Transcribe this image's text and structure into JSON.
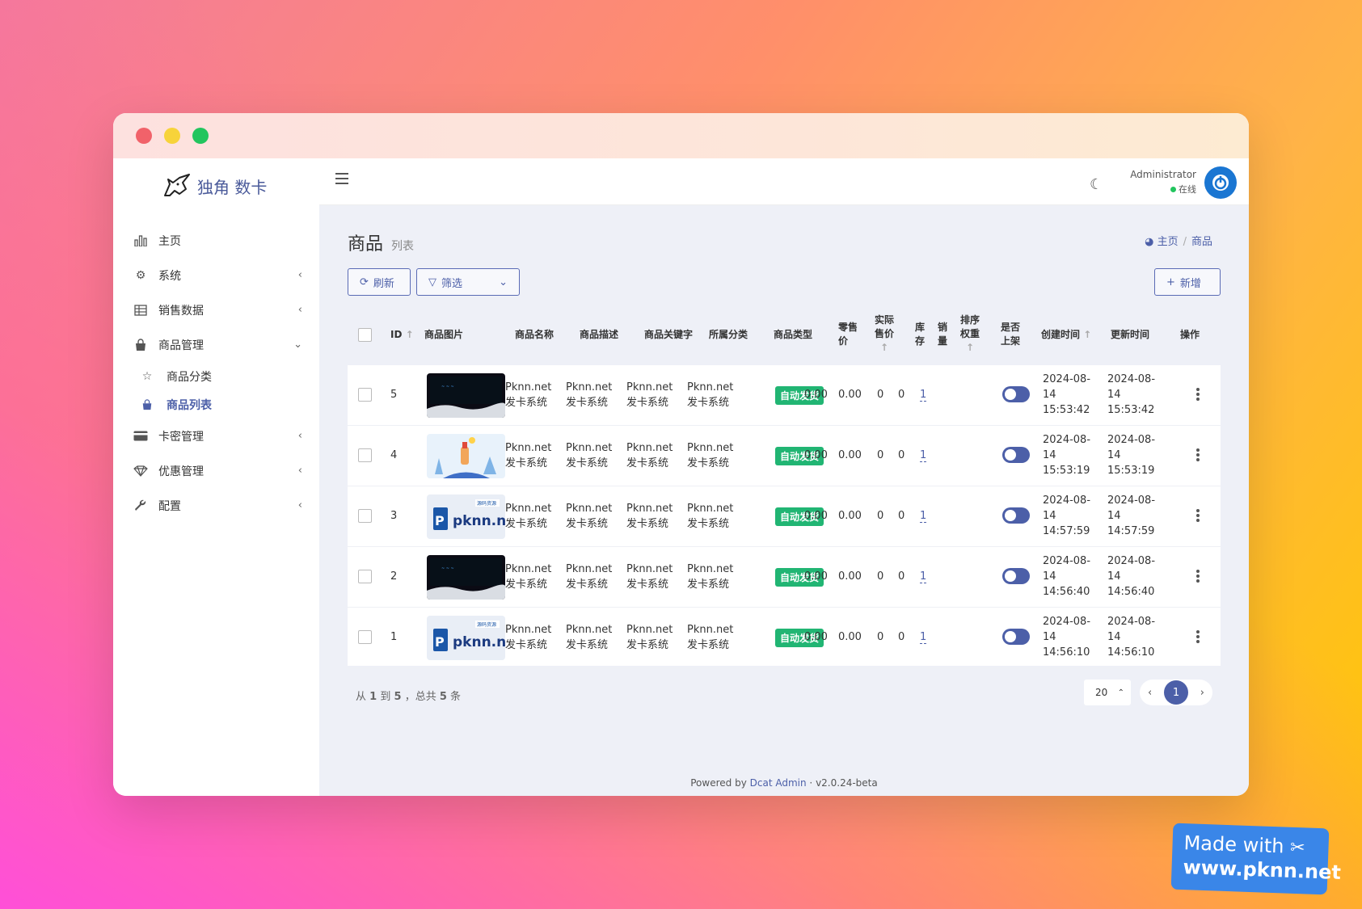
{
  "brand": {
    "name": "独角 数卡"
  },
  "sidebar": {
    "items": [
      {
        "label": "主页"
      },
      {
        "label": "系统"
      },
      {
        "label": "销售数据"
      },
      {
        "label": "商品管理"
      },
      {
        "label": "卡密管理"
      },
      {
        "label": "优惠管理"
      },
      {
        "label": "配置"
      }
    ],
    "sub_items": [
      {
        "label": "商品分类"
      },
      {
        "label": "商品列表"
      }
    ]
  },
  "header": {
    "user_name": "Administrator",
    "user_status": "在线"
  },
  "page": {
    "title": "商品",
    "subtitle": "列表",
    "breadcrumb": [
      "主页",
      "商品"
    ]
  },
  "toolbar": {
    "refresh_label": "刷新",
    "filter_label": "筛选",
    "add_label": "新增"
  },
  "table": {
    "columns": {
      "id": "ID",
      "image": "商品图片",
      "name": "商品名称",
      "desc": "商品描述",
      "keywords": "商品关键字",
      "category": "所属分类",
      "type": "商品类型",
      "retail_1": "零售",
      "retail_2": "价",
      "actual_1": "实际",
      "actual_2": "售价",
      "stock_1": "库",
      "stock_2": "存",
      "sales_1": "销",
      "sales_2": "量",
      "sort_1": "排序",
      "sort_2": "权重",
      "onsale_1": "是否",
      "onsale_2": "上架",
      "created": "创建时间",
      "updated": "更新时间",
      "ops": "操作"
    },
    "rows": [
      {
        "id": "5",
        "thumb": "dark",
        "name_1": "Pknn.net",
        "name_2": "发卡系统",
        "desc_1": "Pknn.net",
        "desc_2": "发卡系统",
        "kw_1": "Pknn.net",
        "kw_2": "发卡系统",
        "cat_1": "Pknn.net",
        "cat_2": "发卡系统",
        "type": "自动发货",
        "retail": "0.00",
        "actual": "0.00",
        "stock": "0",
        "sales": "0",
        "sort": "1",
        "created_1": "2024-08-",
        "created_2": "14",
        "created_3": "15:53:42",
        "updated_1": "2024-08-",
        "updated_2": "14",
        "updated_3": "15:53:42"
      },
      {
        "id": "4",
        "thumb": "illustration",
        "name_1": "Pknn.net",
        "name_2": "发卡系统",
        "desc_1": "Pknn.net",
        "desc_2": "发卡系统",
        "kw_1": "Pknn.net",
        "kw_2": "发卡系统",
        "cat_1": "Pknn.net",
        "cat_2": "发卡系统",
        "type": "自动发货",
        "retail": "0.00",
        "actual": "0.00",
        "stock": "0",
        "sales": "0",
        "sort": "1",
        "created_1": "2024-08-",
        "created_2": "14",
        "created_3": "15:53:19",
        "updated_1": "2024-08-",
        "updated_2": "14",
        "updated_3": "15:53:19"
      },
      {
        "id": "3",
        "thumb": "logo",
        "name_1": "Pknn.net",
        "name_2": "发卡系统",
        "desc_1": "Pknn.net",
        "desc_2": "发卡系统",
        "kw_1": "Pknn.net",
        "kw_2": "发卡系统",
        "cat_1": "Pknn.net",
        "cat_2": "发卡系统",
        "type": "自动发货",
        "retail": "0.00",
        "actual": "0.00",
        "stock": "0",
        "sales": "0",
        "sort": "1",
        "created_1": "2024-08-",
        "created_2": "14",
        "created_3": "14:57:59",
        "updated_1": "2024-08-",
        "updated_2": "14",
        "updated_3": "14:57:59"
      },
      {
        "id": "2",
        "thumb": "dark",
        "name_1": "Pknn.net",
        "name_2": "发卡系统",
        "desc_1": "Pknn.net",
        "desc_2": "发卡系统",
        "kw_1": "Pknn.net",
        "kw_2": "发卡系统",
        "cat_1": "Pknn.net",
        "cat_2": "发卡系统",
        "type": "自动发货",
        "retail": "0.00",
        "actual": "0.00",
        "stock": "0",
        "sales": "0",
        "sort": "1",
        "created_1": "2024-08-",
        "created_2": "14",
        "created_3": "14:56:40",
        "updated_1": "2024-08-",
        "updated_2": "14",
        "updated_3": "14:56:40"
      },
      {
        "id": "1",
        "thumb": "logo",
        "name_1": "Pknn.net",
        "name_2": "发卡系统",
        "desc_1": "Pknn.net",
        "desc_2": "发卡系统",
        "kw_1": "Pknn.net",
        "kw_2": "发卡系统",
        "cat_1": "Pknn.net",
        "cat_2": "发卡系统",
        "type": "自动发货",
        "retail": "0.00",
        "actual": "0.00",
        "stock": "0",
        "sales": "0",
        "sort": "1",
        "created_1": "2024-08-",
        "created_2": "14",
        "created_3": "14:56:10",
        "updated_1": "2024-08-",
        "updated_2": "14",
        "updated_3": "14:56:10"
      }
    ]
  },
  "thumb_logo_text": "pknn.net",
  "thumb_logo_tag": "源码资源",
  "pagination": {
    "summary_pre": "从",
    "from": "1",
    "summary_mid": "到",
    "to": "5",
    "summary_total_pre": "，总共",
    "total": "5",
    "summary_suffix": "条",
    "page_size": "20",
    "current_page": "1"
  },
  "footer": {
    "powered_by": "Powered by",
    "product": "Dcat Admin",
    "version": "v2.0.24-beta"
  },
  "watermark": {
    "line1": "Made with",
    "line2": "www.pknn.net"
  },
  "colors": {
    "accent": "#4c5fa8",
    "badge_green": "#21b573",
    "online_green": "#22c55e"
  }
}
